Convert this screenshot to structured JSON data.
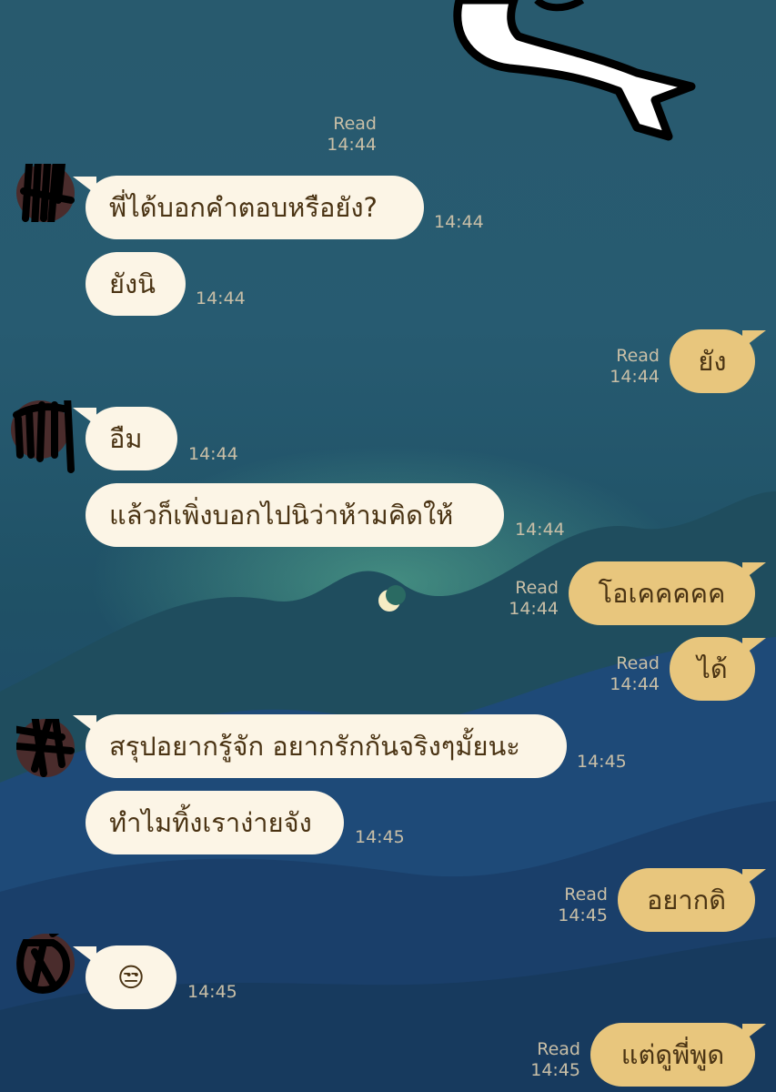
{
  "colors": {
    "incoming_bubble": "#fcf5e6",
    "outgoing_bubble": "#e8c67d",
    "bubble_text": "#4a3313",
    "meta_text": "#c9bfa7"
  },
  "top_status": {
    "read": "Read",
    "time": "14:44"
  },
  "messages": [
    {
      "id": 1,
      "dir": "in",
      "text": "พี่ได้บอกคำตอบหรือยัง?",
      "time": "14:44"
    },
    {
      "id": 2,
      "dir": "in",
      "text": "ยังนิ",
      "time": "14:44"
    },
    {
      "id": 3,
      "dir": "out",
      "text": "ยัง",
      "read": "Read",
      "time": "14:44"
    },
    {
      "id": 4,
      "dir": "in",
      "text": "อืม",
      "time": "14:44"
    },
    {
      "id": 5,
      "dir": "in",
      "text": "แล้วก็เพิ่งบอกไปนิว่าห้ามคิดให้",
      "time": "14:44"
    },
    {
      "id": 6,
      "dir": "out",
      "text": "โอเคคคคค",
      "read": "Read",
      "time": "14:44"
    },
    {
      "id": 7,
      "dir": "out",
      "text": "ได้",
      "read": "Read",
      "time": "14:44"
    },
    {
      "id": 8,
      "dir": "in",
      "text": "สรุปอยากรู้จัก อยากรักกันจริงๆมั้ยนะ",
      "time": "14:45"
    },
    {
      "id": 9,
      "dir": "in",
      "text": "ทำไมทิ้งเราง่ายจัง",
      "time": "14:45"
    },
    {
      "id": 10,
      "dir": "out",
      "text": "อยากดิ",
      "read": "Read",
      "time": "14:45"
    },
    {
      "id": 11,
      "dir": "in",
      "text": "😒",
      "time": "14:45"
    },
    {
      "id": 12,
      "dir": "out",
      "text": "แต่ดูพี่พูด",
      "read": "Read",
      "time": "14:45"
    }
  ]
}
